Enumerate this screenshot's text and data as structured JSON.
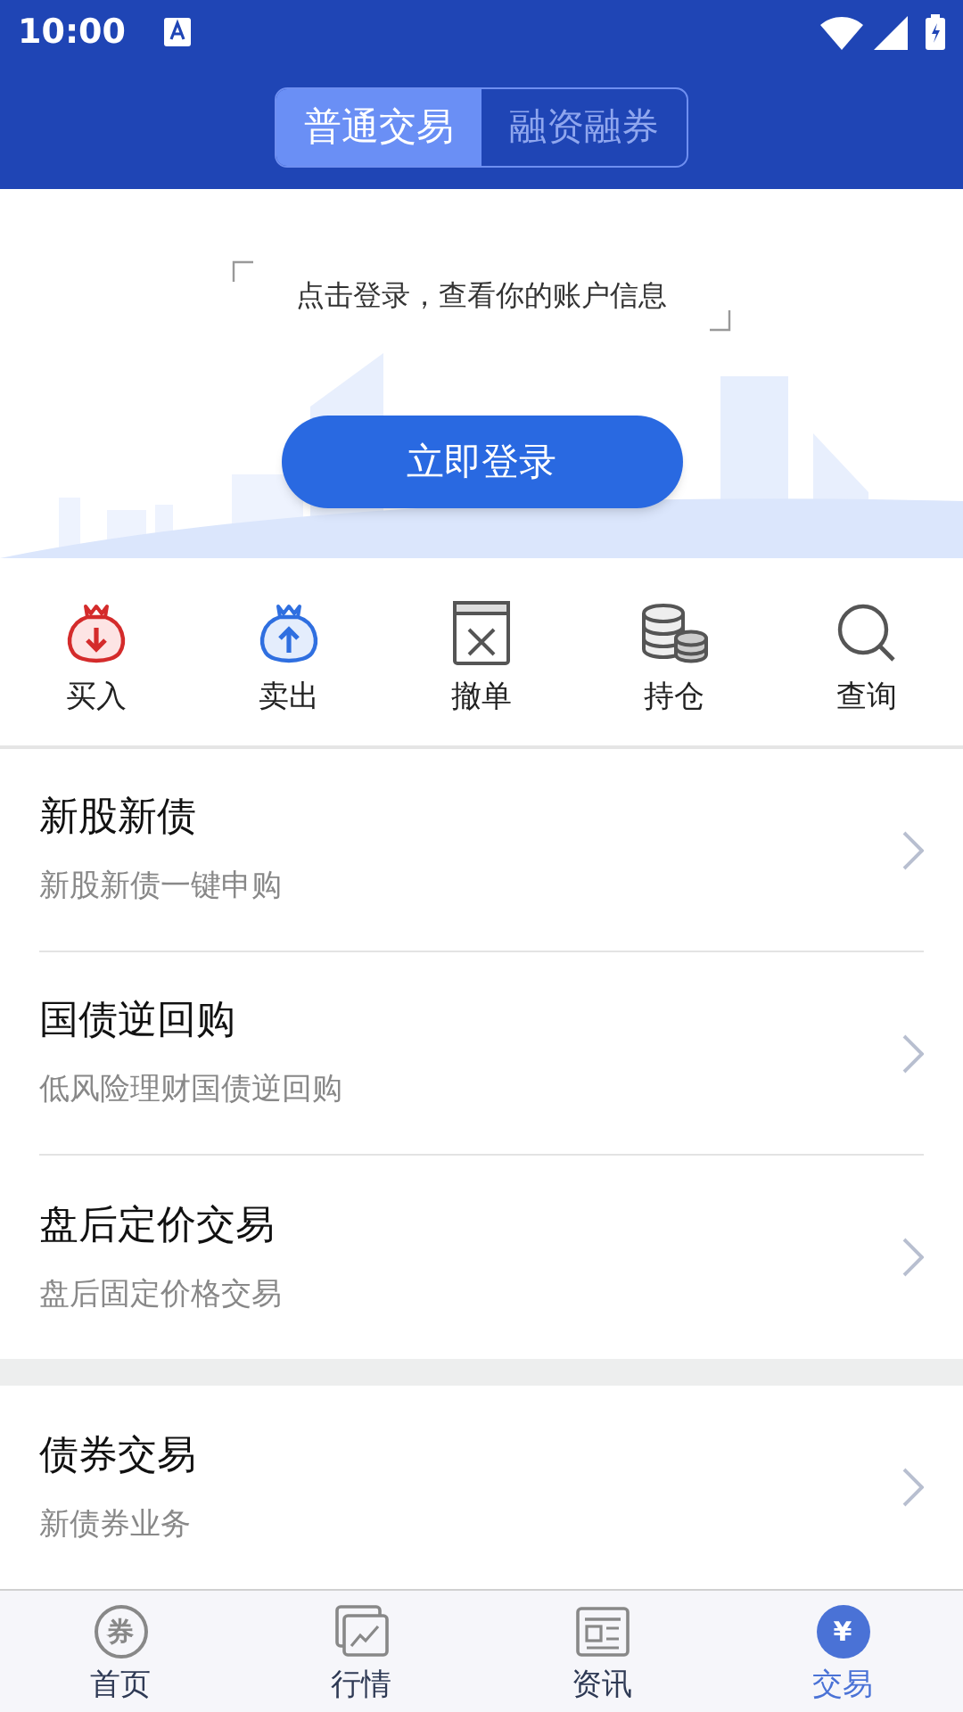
{
  "status_bar": {
    "time": "10:00"
  },
  "segments": [
    {
      "label": "普通交易",
      "selected": true
    },
    {
      "label": "融资融券",
      "selected": false
    }
  ],
  "login": {
    "prompt": "点击登录，查看你的账户信息",
    "button": "立即登录"
  },
  "actions": [
    {
      "label": "买入",
      "kind": "buy"
    },
    {
      "label": "卖出",
      "kind": "sell"
    },
    {
      "label": "撤单",
      "kind": "cancel"
    },
    {
      "label": "持仓",
      "kind": "holdings"
    },
    {
      "label": "查询",
      "kind": "query"
    }
  ],
  "sections": [
    [
      {
        "title": "新股新债",
        "subtitle": "新股新债一键申购"
      },
      {
        "title": "国债逆回购",
        "subtitle": "低风险理财国债逆回购"
      },
      {
        "title": "盘后定价交易",
        "subtitle": "盘后固定价格交易"
      }
    ],
    [
      {
        "title": "债券交易",
        "subtitle": "新债券业务"
      }
    ]
  ],
  "tab_bar": [
    {
      "label": "首页",
      "kind": "home",
      "glyph": "券",
      "selected": false
    },
    {
      "label": "行情",
      "kind": "market",
      "selected": false
    },
    {
      "label": "资讯",
      "kind": "news",
      "selected": false
    },
    {
      "label": "交易",
      "kind": "trade",
      "glyph": "¥",
      "selected": true
    }
  ]
}
